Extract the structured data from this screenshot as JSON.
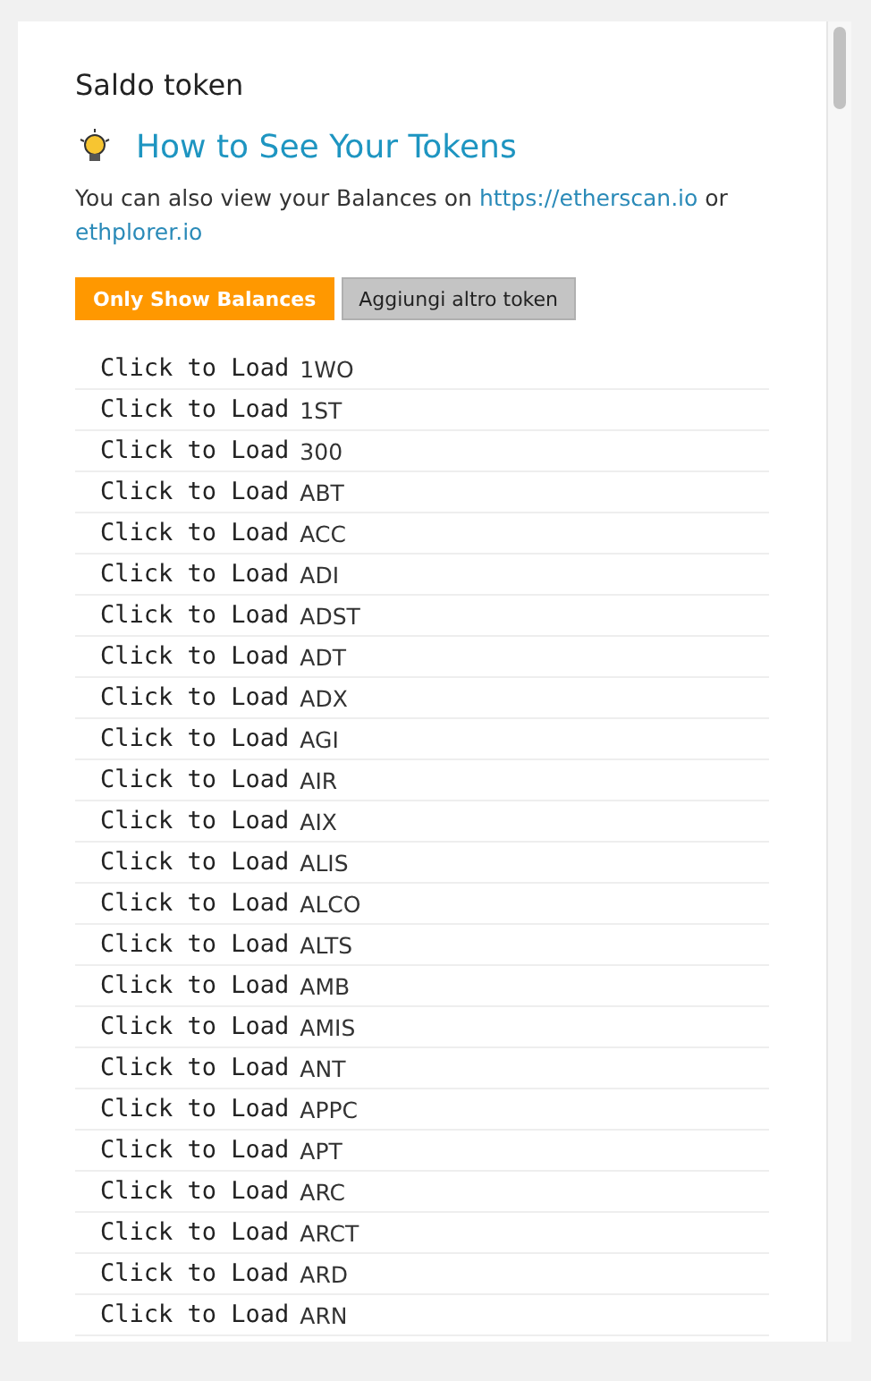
{
  "title": "Saldo token",
  "help": {
    "heading": "How to See Your Tokens",
    "text_before": "You can also view your Balances on",
    "link_1": "https://etherscan.io",
    "text_between": "or",
    "link_2": "ethplorer.io"
  },
  "buttons": [
    {
      "label": "Only Show Balances",
      "kind": "primary"
    },
    {
      "label": "Aggiungi altro token",
      "kind": "secondary"
    }
  ],
  "tokens": [
    {
      "action": "Click to Load",
      "symbol": "1WO"
    },
    {
      "action": "Click to Load",
      "symbol": "1ST"
    },
    {
      "action": "Click to Load",
      "symbol": "300"
    },
    {
      "action": "Click to Load",
      "symbol": "ABT"
    },
    {
      "action": "Click to Load",
      "symbol": "ACC"
    },
    {
      "action": "Click to Load",
      "symbol": "ADI"
    },
    {
      "action": "Click to Load",
      "symbol": "ADST"
    },
    {
      "action": "Click to Load",
      "symbol": "ADT"
    },
    {
      "action": "Click to Load",
      "symbol": "ADX"
    },
    {
      "action": "Click to Load",
      "symbol": "AGI"
    },
    {
      "action": "Click to Load",
      "symbol": "AIR"
    },
    {
      "action": "Click to Load",
      "symbol": "AIX"
    },
    {
      "action": "Click to Load",
      "symbol": "ALIS"
    },
    {
      "action": "Click to Load",
      "symbol": "ALCO"
    },
    {
      "action": "Click to Load",
      "symbol": "ALTS"
    },
    {
      "action": "Click to Load",
      "symbol": "AMB"
    },
    {
      "action": "Click to Load",
      "symbol": "AMIS"
    },
    {
      "action": "Click to Load",
      "symbol": "ANT"
    },
    {
      "action": "Click to Load",
      "symbol": "APPC"
    },
    {
      "action": "Click to Load",
      "symbol": "APT"
    },
    {
      "action": "Click to Load",
      "symbol": "ARC"
    },
    {
      "action": "Click to Load",
      "symbol": "ARCT"
    },
    {
      "action": "Click to Load",
      "symbol": "ARD"
    },
    {
      "action": "Click to Load",
      "symbol": "ARN"
    }
  ]
}
